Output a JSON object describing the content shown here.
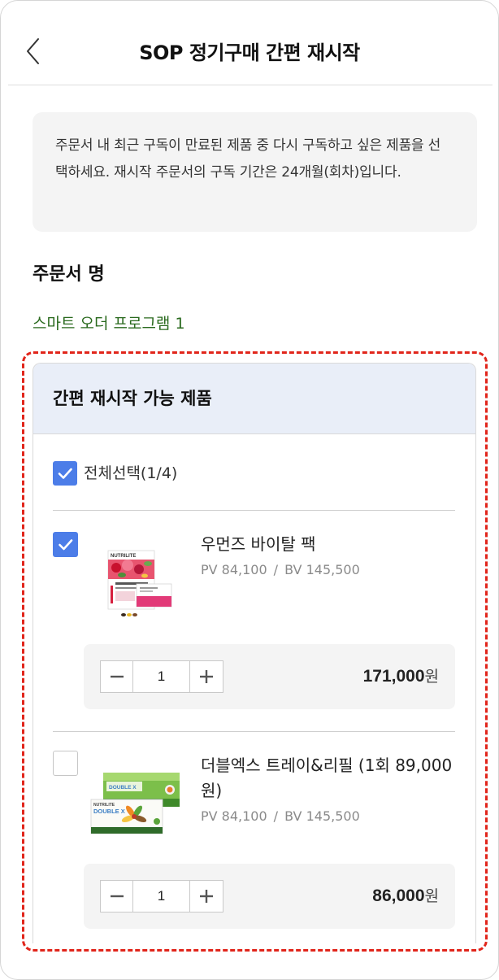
{
  "header": {
    "title": "SOP 정기구매 간편 재시작"
  },
  "notice": {
    "text": "주문서 내 최근 구독이 만료된 제품 중 다시 구독하고 싶은 제품을 선택하세요. 재시작 주문서의 구독 기간은 24개월(회차)입니다."
  },
  "order": {
    "label": "주문서 명",
    "name": "스마트 오더 프로그램 1"
  },
  "product_card": {
    "title": "간편 재시작 가능 제품",
    "select_all": {
      "label": "전체선택(1/4)",
      "checked": true
    },
    "items": [
      {
        "name": "우먼즈 바이탈 팩",
        "pv": "PV 84,100",
        "separator": "/",
        "bv": "BV 145,500",
        "checked": true,
        "quantity": "1",
        "price": "171,000",
        "currency": "원",
        "brand_mark": "NUTRILITE"
      },
      {
        "name": "더블엑스 트레이&리필 (1회 89,000원)",
        "pv": "PV 84,100",
        "separator": "/",
        "bv": "BV 145,500",
        "checked": false,
        "quantity": "1",
        "price": "86,000",
        "currency": "원",
        "brand_mark": "NUTRILITE",
        "product_mark": "DOUBLE X"
      }
    ]
  },
  "icons": {
    "back": "chevron-left-icon",
    "check": "check-icon",
    "decrease": "minus-icon",
    "increase": "plus-icon"
  },
  "colors": {
    "accent": "#4c7de8",
    "order_name": "#2a6a1e",
    "highlight_border": "#e1251b",
    "card_header_bg": "#e9eef8"
  }
}
